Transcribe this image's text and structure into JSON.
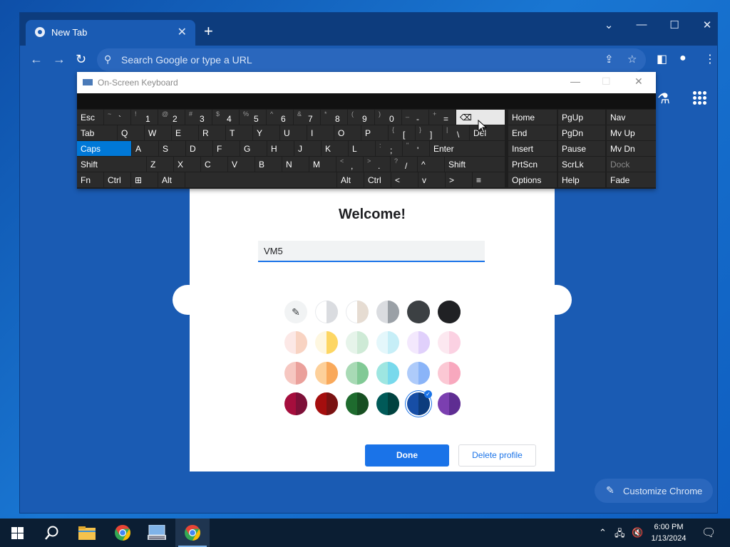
{
  "browser": {
    "tab_title": "New Tab",
    "new_tab_symbol": "+",
    "close_tab_symbol": "✕",
    "omnibox_placeholder": "Search Google or type a URL",
    "customize_label": "Customize Chrome"
  },
  "dialog": {
    "title": "Welcome!",
    "name_value": "VM5",
    "done_label": "Done",
    "delete_label": "Delete profile",
    "selected_color": "#174ea6",
    "swatches": [
      [
        null,
        [
          "#ffffff",
          "#dadce0"
        ],
        [
          "#ffffff",
          "#e6dcd2"
        ],
        [
          "#dadce0",
          "#9aa0a6"
        ],
        [
          "#3c4043",
          "#3c4043"
        ],
        [
          "#202124",
          "#202124"
        ]
      ],
      [
        [
          "#fce8e6",
          "#f8d3c2"
        ],
        [
          "#fef7e0",
          "#fdd663"
        ],
        [
          "#e6f4ea",
          "#ceead6"
        ],
        [
          "#e4f7fb",
          "#c6eef7"
        ],
        [
          "#f3e8fd",
          "#e0d0fb"
        ],
        [
          "#fce8f0",
          "#fbd1e2"
        ]
      ],
      [
        [
          "#f6c7c1",
          "#eaa09b"
        ],
        [
          "#fdd09a",
          "#f9a95b"
        ],
        [
          "#a8dab5",
          "#81c995"
        ],
        [
          "#9ee6e1",
          "#78d9ec"
        ],
        [
          "#aecbfa",
          "#8ab4f8"
        ],
        [
          "#fbc8d4",
          "#f8a8be"
        ]
      ],
      [
        [
          "#a50e3d",
          "#7d1038"
        ],
        [
          "#a50e0e",
          "#7a1212"
        ],
        [
          "#1e6b2e",
          "#174f22"
        ],
        [
          "#005a58",
          "#00423f"
        ],
        [
          "#174ea6",
          "#0d3c7d"
        ],
        [
          "#7b3fb0",
          "#5e2d92"
        ]
      ]
    ]
  },
  "osk": {
    "title": "On-Screen Keyboard",
    "rows": [
      [
        [
          "Esc",
          ""
        ],
        [
          "`",
          "~"
        ],
        [
          "1",
          "!"
        ],
        [
          "2",
          "@"
        ],
        [
          "3",
          "#"
        ],
        [
          "4",
          "$"
        ],
        [
          "5",
          "%"
        ],
        [
          "6",
          "^"
        ],
        [
          "7",
          "&"
        ],
        [
          "8",
          "*"
        ],
        [
          "9",
          "("
        ],
        [
          "0",
          ")"
        ],
        [
          "-",
          "_"
        ],
        [
          "=",
          "+"
        ],
        [
          "⌫",
          ""
        ]
      ],
      [
        [
          "Tab",
          ""
        ],
        [
          "Q",
          ""
        ],
        [
          "W",
          ""
        ],
        [
          "E",
          ""
        ],
        [
          "R",
          ""
        ],
        [
          "T",
          ""
        ],
        [
          "Y",
          ""
        ],
        [
          "U",
          ""
        ],
        [
          "I",
          ""
        ],
        [
          "O",
          ""
        ],
        [
          "P",
          ""
        ],
        [
          "[",
          "{"
        ],
        [
          "]",
          "}"
        ],
        [
          "\\",
          "|"
        ],
        [
          "Del",
          ""
        ]
      ],
      [
        [
          "Caps",
          ""
        ],
        [
          "A",
          ""
        ],
        [
          "S",
          ""
        ],
        [
          "D",
          ""
        ],
        [
          "F",
          ""
        ],
        [
          "G",
          ""
        ],
        [
          "H",
          ""
        ],
        [
          "J",
          ""
        ],
        [
          "K",
          ""
        ],
        [
          "L",
          ""
        ],
        [
          ";",
          ":"
        ],
        [
          "'",
          "\""
        ],
        [
          "Enter",
          ""
        ]
      ],
      [
        [
          "Shift",
          ""
        ],
        [
          "Z",
          ""
        ],
        [
          "X",
          ""
        ],
        [
          "C",
          ""
        ],
        [
          "V",
          ""
        ],
        [
          "B",
          ""
        ],
        [
          "N",
          ""
        ],
        [
          "M",
          ""
        ],
        [
          ",",
          "<"
        ],
        [
          ".",
          ">"
        ],
        [
          "/",
          "?"
        ],
        [
          "^",
          ""
        ],
        [
          "Shift",
          ""
        ]
      ],
      [
        [
          "Fn",
          ""
        ],
        [
          "Ctrl",
          ""
        ],
        [
          "⊞",
          ""
        ],
        [
          "Alt",
          ""
        ],
        [
          "",
          ""
        ],
        [
          "Alt",
          ""
        ],
        [
          "Ctrl",
          ""
        ],
        [
          "<",
          ""
        ],
        [
          "v",
          ""
        ],
        [
          ">",
          ""
        ],
        [
          "≡",
          ""
        ]
      ]
    ],
    "nav": [
      [
        "Home",
        "PgUp",
        "Nav"
      ],
      [
        "End",
        "PgDn",
        "Mv Up"
      ],
      [
        "Insert",
        "Pause",
        "Mv Dn"
      ],
      [
        "PrtScn",
        "ScrLk",
        "Dock"
      ],
      [
        "Options",
        "Help",
        "Fade"
      ]
    ]
  },
  "taskbar": {
    "time": "6:00 PM",
    "date": "1/13/2024"
  }
}
